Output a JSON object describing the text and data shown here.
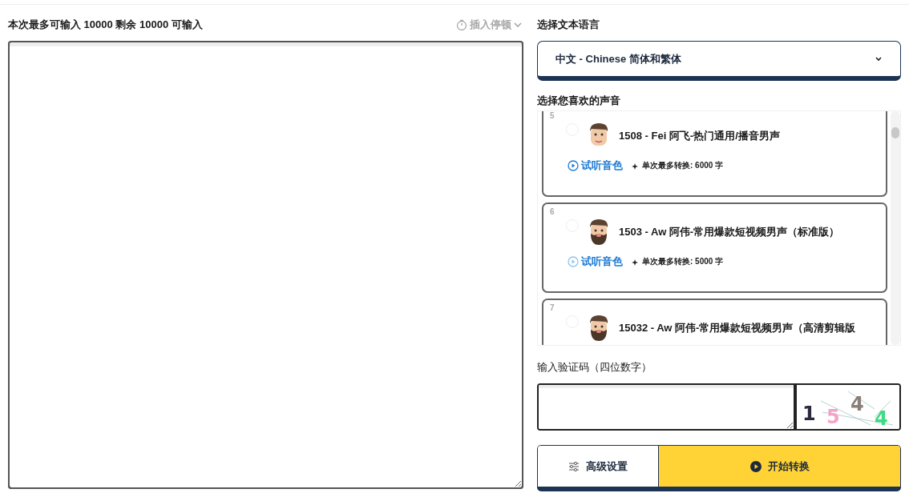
{
  "editor": {
    "limit_text": "本次最多可输入 10000 剩余 10000 可输入",
    "pause_button": "插入停顿"
  },
  "language": {
    "label": "选择文本语言",
    "value": "中文 - Chinese 简体和繁体"
  },
  "voices": {
    "label": "选择您喜欢的声音",
    "items": [
      {
        "index": "5",
        "name": "1508 - Fei 阿飞-热门通用/播音男声",
        "selected": false,
        "preview": "试听音色",
        "limit": "单次最多转换: 6000 字"
      },
      {
        "index": "6",
        "name": "1503 - Aw 阿伟-常用爆款短视频男声（标准版）",
        "selected": false,
        "preview": "试听音色",
        "limit": "单次最多转换: 5000 字"
      },
      {
        "index": "7",
        "name": "15032 - Aw 阿伟-常用爆款短视频男声（高清剪辑版",
        "selected": false
      }
    ]
  },
  "captcha": {
    "label": "输入验证码（四位数字）",
    "chars": [
      {
        "char": "1",
        "color": "#2b2a40"
      },
      {
        "char": "5",
        "color": "#f4a3c8"
      },
      {
        "char": "4",
        "color": "#8a7f78"
      },
      {
        "char": "4",
        "color": "#3ddc84"
      }
    ]
  },
  "actions": {
    "settings": "高级设置",
    "start": "开始转换"
  }
}
